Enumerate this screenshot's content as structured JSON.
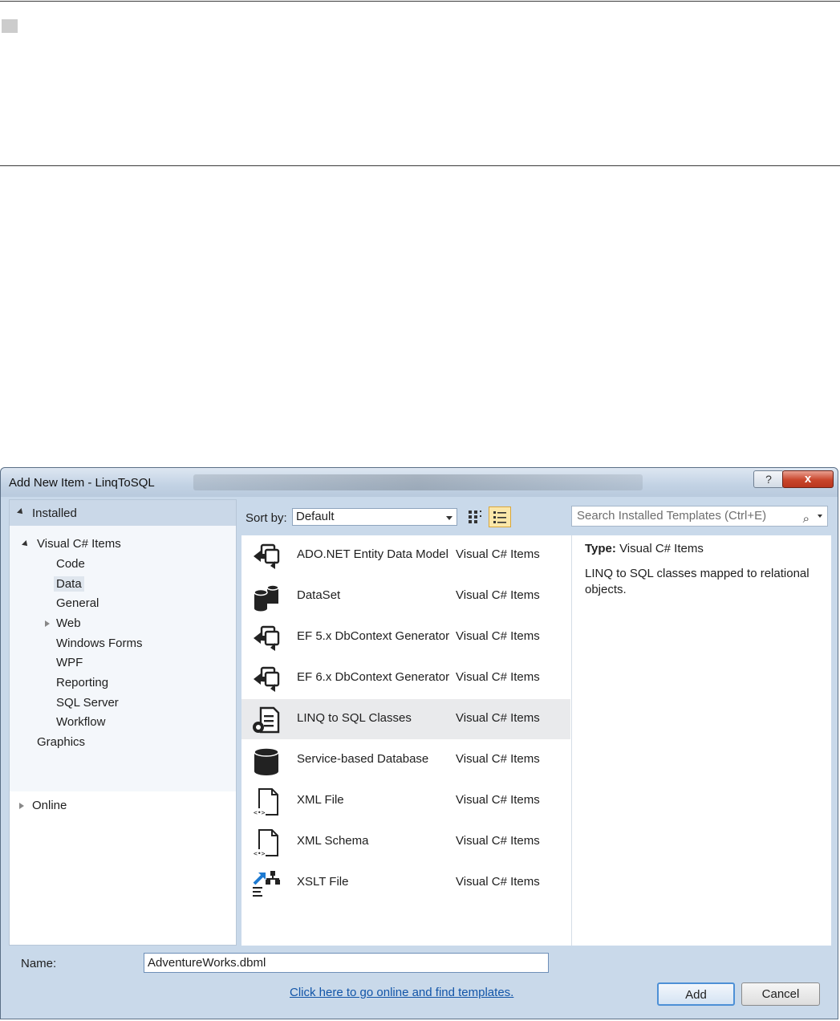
{
  "dialog": {
    "title": "Add New Item - LinqToSQL",
    "help_glyph": "?",
    "close_glyph": "x"
  },
  "categories": {
    "header": "Installed",
    "root": "Visual C# Items",
    "children": [
      "Code",
      "Data",
      "General",
      "Web",
      "Windows Forms",
      "WPF",
      "Reporting",
      "SQL Server",
      "Workflow"
    ],
    "selected": "Data",
    "graphics": "Graphics",
    "online": "Online"
  },
  "toolbar": {
    "sort_label": "Sort by:",
    "sort_value": "Default",
    "search_placeholder": "Search Installed Templates (Ctrl+E)",
    "search_icon": "magnifier-icon"
  },
  "templates": [
    {
      "name": "ADO.NET Entity Data Model",
      "category": "Visual C# Items",
      "icon": "entity-model-icon"
    },
    {
      "name": "DataSet",
      "category": "Visual C# Items",
      "icon": "dataset-icon"
    },
    {
      "name": "EF 5.x DbContext Generator",
      "category": "Visual C# Items",
      "icon": "entity-model-icon"
    },
    {
      "name": "EF 6.x DbContext Generator",
      "category": "Visual C# Items",
      "icon": "entity-model-icon"
    },
    {
      "name": "LINQ to SQL Classes",
      "category": "Visual C# Items",
      "icon": "linq-classes-icon"
    },
    {
      "name": "Service-based Database",
      "category": "Visual C# Items",
      "icon": "database-icon"
    },
    {
      "name": "XML File",
      "category": "Visual C# Items",
      "icon": "xml-file-icon"
    },
    {
      "name": "XML Schema",
      "category": "Visual C# Items",
      "icon": "xml-file-icon"
    },
    {
      "name": "XSLT File",
      "category": "Visual C# Items",
      "icon": "xslt-file-icon"
    }
  ],
  "selected_template": "LINQ to SQL Classes",
  "online_link": "Click here to go online and find templates.",
  "description": {
    "type_label": "Type:",
    "type_value": "Visual C# Items",
    "text": "LINQ to SQL classes mapped to relational objects."
  },
  "name_field": {
    "label": "Name:",
    "value": "AdventureWorks.dbml"
  },
  "buttons": {
    "add": "Add",
    "cancel": "Cancel"
  },
  "colors": {
    "dialog_bg": "#c9d9ea",
    "link": "#1255a8",
    "selection": "#e9eaec",
    "close_red": "#c9452b"
  }
}
